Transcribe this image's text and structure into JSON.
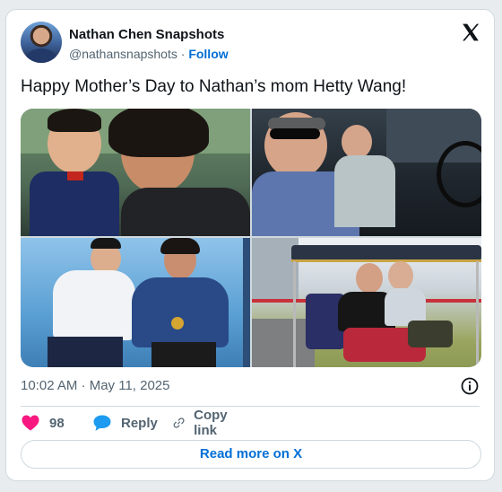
{
  "author": {
    "name": "Nathan Chen Snapshots",
    "handle": "@nathansnapshots",
    "separator": "·",
    "follow_label": "Follow"
  },
  "tweet": {
    "text": "Happy Mother’s Day to Nathan’s mom Hetty Wang!",
    "timestamp": "10:02 AM · May 11, 2025"
  },
  "icons": {
    "platform": "x-logo-icon",
    "info": "info-icon",
    "like": "heart-icon",
    "reply": "speech-bubble-icon",
    "copy_link": "link-icon"
  },
  "actions": {
    "likes_count": "98",
    "reply_label": "Reply",
    "copy_link_label": "Copy link"
  },
  "footer": {
    "read_more_label": "Read more on X"
  },
  "colors": {
    "accent": "#006fd6",
    "like": "#f91880",
    "reply": "#1d9bf0",
    "muted": "#536471",
    "border": "#cfd9de"
  }
}
